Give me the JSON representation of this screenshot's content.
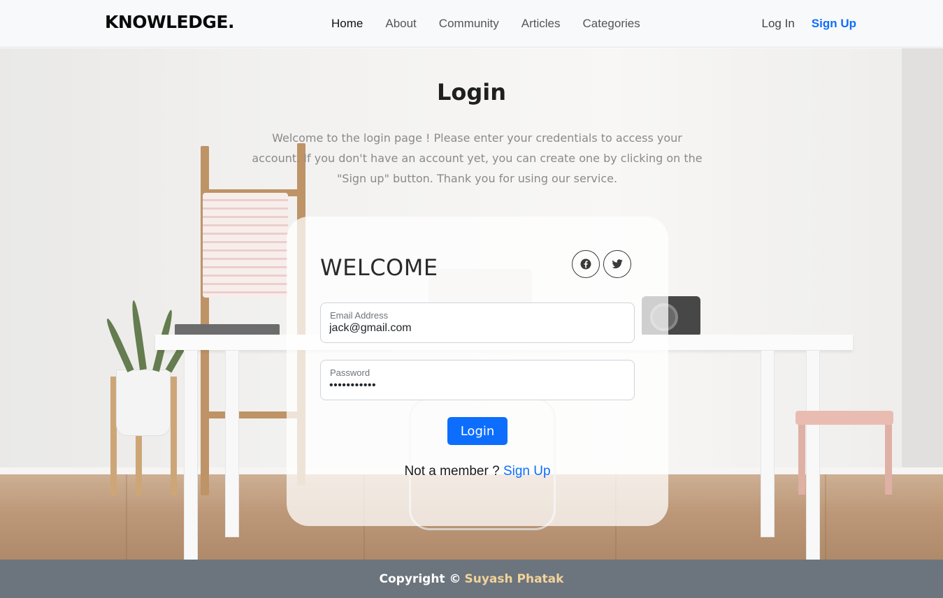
{
  "navbar": {
    "brand": "KNOWLEDGE.",
    "links": [
      "Home",
      "About",
      "Community",
      "Articles",
      "Categories"
    ],
    "active_link": "Home",
    "login_label": "Log In",
    "signup_label": "Sign Up"
  },
  "hero": {
    "title": "Login",
    "intro": "Welcome to the login page ! Please enter your credentials to access your account. If you don't have an account yet, you can create one by clicking on the \"Sign up\" button. Thank you for using our service."
  },
  "login_card": {
    "heading": "WELCOME",
    "social_icons": [
      "facebook-icon",
      "twitter-icon"
    ],
    "email": {
      "label": "Email Address",
      "value": "jack@gmail.com"
    },
    "password": {
      "label": "Password",
      "value": "•••••••••••"
    },
    "submit_label": "Login",
    "member_prompt": "Not a member ?",
    "member_signup_label": "Sign Up"
  },
  "footer": {
    "copyright": "Copyright ©",
    "author": "Suyash Phatak"
  },
  "colors": {
    "accent": "#0d6efd",
    "footer_bg": "#6c757d",
    "author": "#f3d39a"
  }
}
